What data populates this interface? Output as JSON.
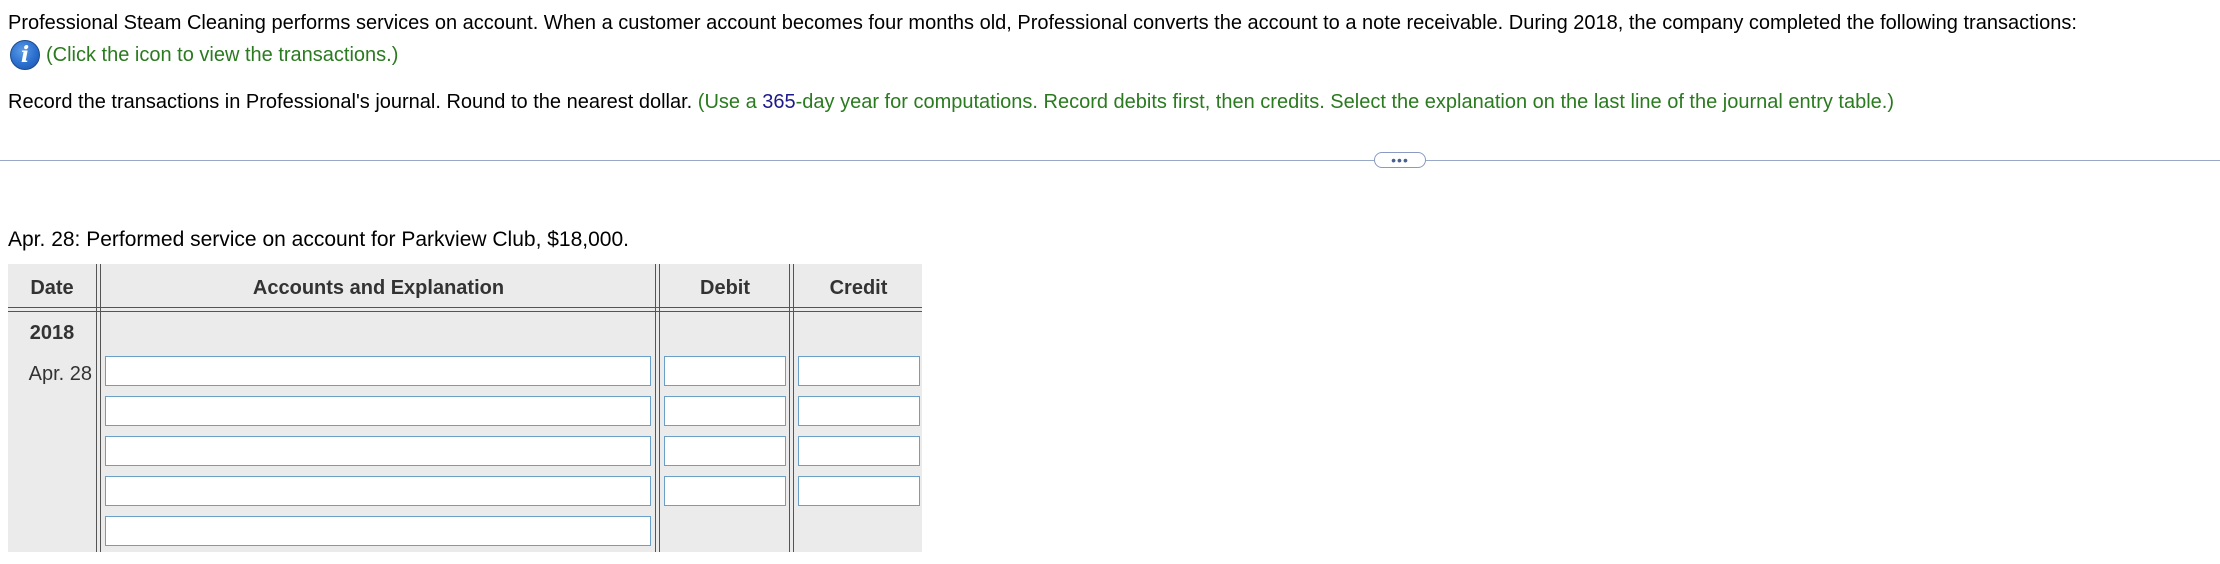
{
  "problem": {
    "statement": "Professional Steam Cleaning performs services on account. When a customer account becomes four months old, Professional converts the account to a note receivable. During 2018, the company completed the following transactions:",
    "info_link": "(Click the icon to view the transactions.)",
    "info_icon": "info-icon"
  },
  "instructions": {
    "main": "Record the transactions in Professional's journal. Round to the nearest dollar.",
    "hint_prefix": "(Use a ",
    "hint_number": "365",
    "hint_suffix": "-day year for computations. Record debits first, then credits. Select the explanation on the last line of the journal entry table.)"
  },
  "expand_button": "•••",
  "transaction": {
    "description": "Apr. 28: Performed service on account for Parkview Club, $18,000."
  },
  "journal": {
    "headers": {
      "date": "Date",
      "accounts": "Accounts and Explanation",
      "debit": "Debit",
      "credit": "Credit"
    },
    "year": "2018",
    "date": "Apr. 28",
    "rows": [
      {
        "account": "",
        "debit": "",
        "credit": ""
      },
      {
        "account": "",
        "debit": "",
        "credit": ""
      },
      {
        "account": "",
        "debit": "",
        "credit": ""
      },
      {
        "account": "",
        "debit": "",
        "credit": ""
      },
      {
        "account": ""
      }
    ]
  },
  "colors": {
    "hint_green": "#2a7a1f",
    "number_blue": "#1c1a8a",
    "table_bg": "#ebebeb",
    "input_border": "#6aa0c8"
  }
}
